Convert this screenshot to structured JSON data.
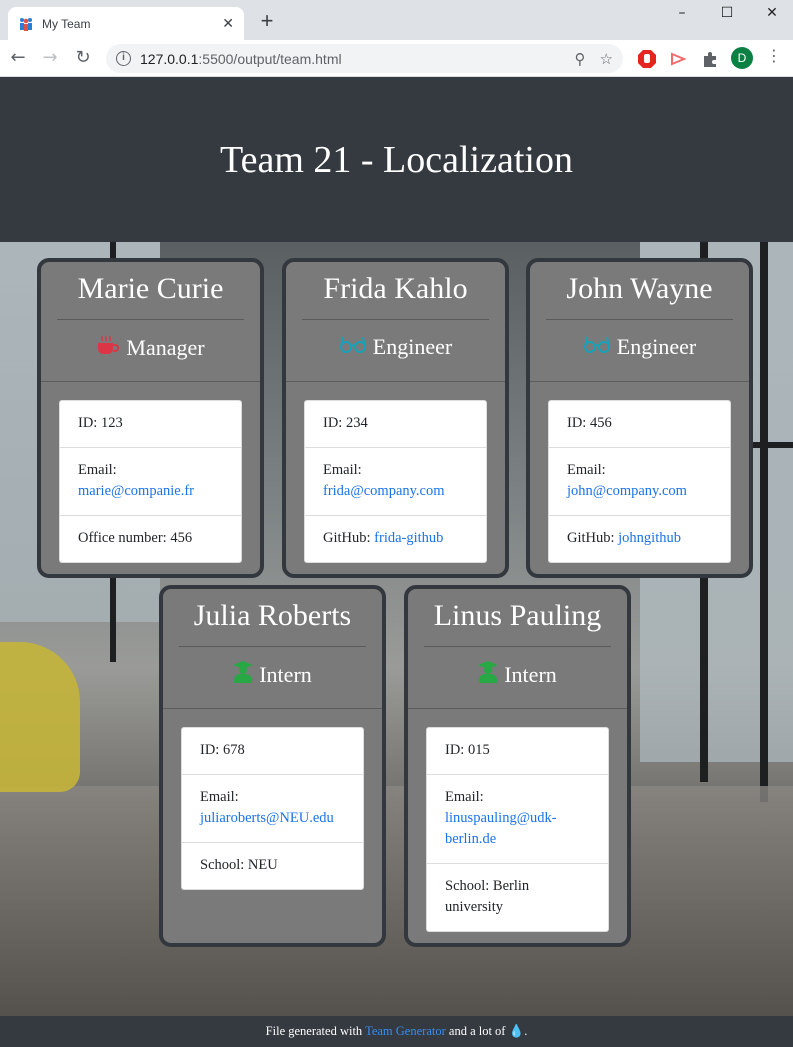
{
  "browser": {
    "tab_title": "My Team",
    "tab_close": "✕",
    "new_tab": "+",
    "window_controls": {
      "minimize": "–",
      "maximize": "☐",
      "close": "✕"
    },
    "nav": {
      "back": "←",
      "forward": "→",
      "reload": "↻"
    },
    "url_host": "127.0.0.1",
    "url_path": ":5500/output/team.html",
    "profile_initial": "D",
    "menu": "⋮"
  },
  "header": {
    "title": "Team 21 - Localization"
  },
  "members": [
    {
      "name": "Marie Curie",
      "role": "Manager",
      "role_icon": "coffee-icon",
      "icon_color": "#dc3545",
      "id": "ID: 123",
      "email_label": "Email:",
      "email": "marie@companie.fr",
      "extra_label": "Office number: 456",
      "extra_value": ""
    },
    {
      "name": "Frida Kahlo",
      "role": "Engineer",
      "role_icon": "glasses-icon",
      "icon_color": "#17a2b8",
      "id": "ID: 234",
      "email_label": "Email:",
      "email": "frida@company.com",
      "extra_label": "GitHub: ",
      "extra_value": "frida-github"
    },
    {
      "name": "John Wayne",
      "role": "Engineer",
      "role_icon": "glasses-icon",
      "icon_color": "#17a2b8",
      "id": "ID: 456",
      "email_label": "Email:",
      "email": "john@company.com",
      "extra_label": "GitHub: ",
      "extra_value": "johngithub"
    },
    {
      "name": "Julia Roberts",
      "role": "Intern",
      "role_icon": "graduate-icon",
      "icon_color": "#28a745",
      "id": "ID: 678",
      "email_label": "Email:",
      "email": "juliaroberts@NEU.edu",
      "extra_label": "School: NEU",
      "extra_value": ""
    },
    {
      "name": "Linus Pauling",
      "role": "Intern",
      "role_icon": "graduate-icon",
      "icon_color": "#28a745",
      "id": "ID: 015",
      "email_label": "Email:",
      "email": "linuspauling@udk-berlin.de",
      "extra_label": "School: Berlin university",
      "extra_value": ""
    }
  ],
  "footer": {
    "prefix": "File generated with ",
    "link": "Team Generator",
    "suffix": " and a lot of ",
    "icon": "💧",
    "end": "."
  }
}
